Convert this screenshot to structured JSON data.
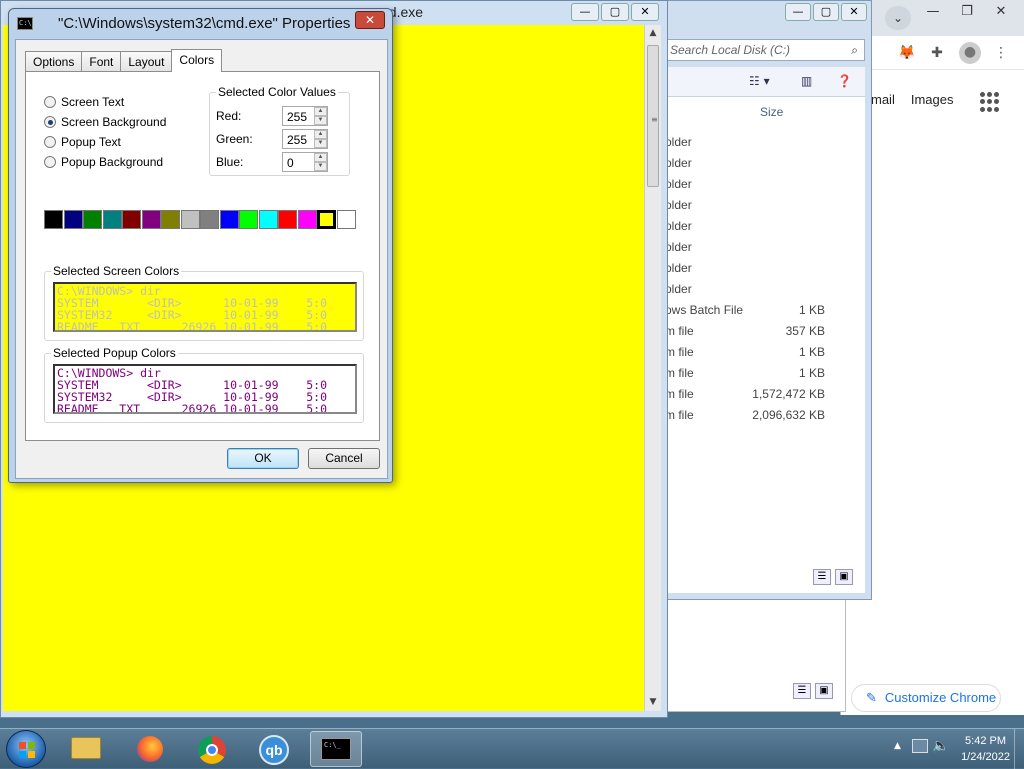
{
  "chrome": {
    "tab_dropdown": "⌄",
    "window_buttons": [
      "—",
      "❐",
      "✕"
    ],
    "links": [
      "mail",
      "Images"
    ],
    "customize_label": "Customize Chrome"
  },
  "explorer": {
    "search_placeholder": "Search Local Disk (C:)",
    "window_buttons": [
      "—",
      "▢",
      "✕"
    ],
    "column_size": "Size",
    "rows": [
      {
        "type": "older",
        "size": ""
      },
      {
        "type": "older",
        "size": ""
      },
      {
        "type": "older",
        "size": ""
      },
      {
        "type": "older",
        "size": ""
      },
      {
        "type": "older",
        "size": ""
      },
      {
        "type": "older",
        "size": ""
      },
      {
        "type": "older",
        "size": ""
      },
      {
        "type": "older",
        "size": ""
      },
      {
        "type": "ows Batch File",
        "size": "1 KB"
      },
      {
        "type": "m file",
        "size": "357 KB"
      },
      {
        "type": "m file",
        "size": "1 KB"
      },
      {
        "type": "m file",
        "size": "1 KB"
      },
      {
        "type": "m file",
        "size": "1,572,472 KB"
      },
      {
        "type": "m file",
        "size": "2,096,632 KB"
      }
    ]
  },
  "cmd": {
    "title": "nd.exe",
    "window_buttons": [
      "—",
      "▢",
      "✕"
    ]
  },
  "dialog": {
    "title": "\"C:\\Windows\\system32\\cmd.exe\" Properties",
    "close": "✕",
    "tabs": [
      "Options",
      "Font",
      "Layout",
      "Colors"
    ],
    "active_tab": "Colors",
    "radios": [
      {
        "label": "Screen Text",
        "checked": false
      },
      {
        "label": "Screen Background",
        "checked": true
      },
      {
        "label": "Popup Text",
        "checked": false
      },
      {
        "label": "Popup Background",
        "checked": false
      }
    ],
    "color_values": {
      "legend": "Selected Color Values",
      "red_label": "Red:",
      "red": "255",
      "green_label": "Green:",
      "green": "255",
      "blue_label": "Blue:",
      "blue": "0"
    },
    "palette": [
      "#000000",
      "#000080",
      "#008000",
      "#008080",
      "#800000",
      "#800080",
      "#808000",
      "#c0c0c0",
      "#808080",
      "#0000ff",
      "#00ff00",
      "#00ffff",
      "#ff0000",
      "#ff00ff",
      "#ffff00",
      "#ffffff"
    ],
    "selected_palette_index": 14,
    "screen_colors": {
      "legend": "Selected Screen Colors",
      "lines": [
        "C:\\WINDOWS> dir",
        "SYSTEM       <DIR>      10-01-99    5:0",
        "SYSTEM32     <DIR>      10-01-99    5:0",
        "README   TXT      26926 10-01-99    5:0"
      ],
      "fg": "#c0c0c0",
      "bg": "#ffff00"
    },
    "popup_colors": {
      "legend": "Selected Popup Colors",
      "lines": [
        "C:\\WINDOWS> dir",
        "SYSTEM       <DIR>      10-01-99    5:0",
        "SYSTEM32     <DIR>      10-01-99    5:0",
        "README   TXT      26926 10-01-99    5:0"
      ],
      "fg": "#800080",
      "bg": "#ffffff"
    },
    "ok_label": "OK",
    "cancel_label": "Cancel"
  },
  "taskbar": {
    "items": [
      "start-button",
      "explorer-icon",
      "firefox-icon",
      "chrome-icon",
      "qbittorrent-icon",
      "cmd-icon"
    ],
    "qb_label": "qb",
    "time": "5:42 PM",
    "date": "1/24/2022"
  }
}
